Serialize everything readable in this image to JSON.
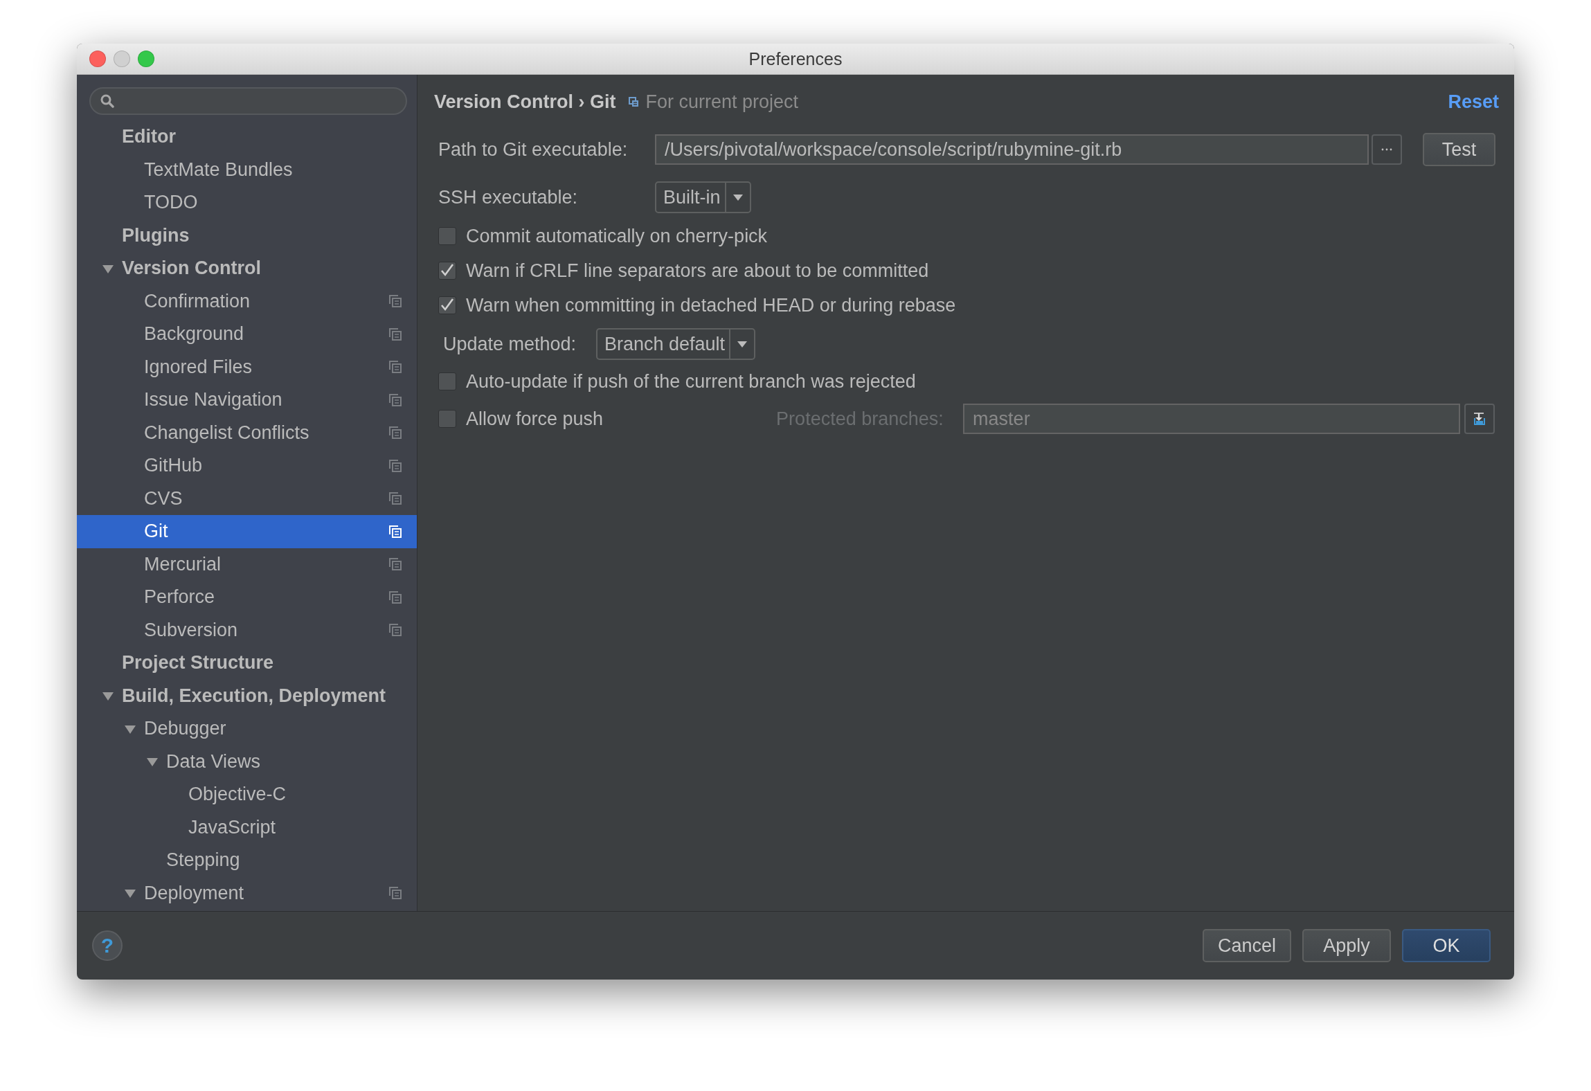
{
  "window": {
    "title": "Preferences",
    "traffic_lights": [
      {
        "kind": "close",
        "disabled": false
      },
      {
        "kind": "minimize",
        "disabled": true
      },
      {
        "kind": "zoom",
        "disabled": false
      }
    ]
  },
  "sidebar": {
    "items": [
      {
        "label": "Editor",
        "selected": false,
        "per_project": false,
        "children": [
          {
            "label": "TextMate Bundles",
            "selected": false,
            "per_project": false
          },
          {
            "label": "TODO",
            "selected": false,
            "per_project": false
          }
        ]
      },
      {
        "label": "Plugins",
        "selected": false,
        "per_project": false
      },
      {
        "label": "Version Control",
        "selected": false,
        "per_project": false,
        "expanded": true,
        "children": [
          {
            "label": "Confirmation",
            "selected": false,
            "per_project": true
          },
          {
            "label": "Background",
            "selected": false,
            "per_project": true
          },
          {
            "label": "Ignored Files",
            "selected": false,
            "per_project": true
          },
          {
            "label": "Issue Navigation",
            "selected": false,
            "per_project": true
          },
          {
            "label": "Changelist Conflicts",
            "selected": false,
            "per_project": true
          },
          {
            "label": "GitHub",
            "selected": false,
            "per_project": true
          },
          {
            "label": "CVS",
            "selected": false,
            "per_project": true
          },
          {
            "label": "Git",
            "selected": true,
            "per_project": true
          },
          {
            "label": "Mercurial",
            "selected": false,
            "per_project": true
          },
          {
            "label": "Perforce",
            "selected": false,
            "per_project": true
          },
          {
            "label": "Subversion",
            "selected": false,
            "per_project": true
          }
        ]
      },
      {
        "label": "Project Structure",
        "selected": false,
        "per_project": false
      },
      {
        "label": "Build, Execution, Deployment",
        "selected": false,
        "per_project": false,
        "expanded": true,
        "children": [
          {
            "label": "Debugger",
            "selected": false,
            "per_project": false,
            "expanded": true,
            "children": [
              {
                "label": "Data Views",
                "selected": false,
                "per_project": false,
                "expanded": true,
                "children": [
                  {
                    "label": "Objective-C",
                    "selected": false,
                    "per_project": false
                  },
                  {
                    "label": "JavaScript",
                    "selected": false,
                    "per_project": false
                  }
                ]
              },
              {
                "label": "Stepping",
                "selected": false,
                "per_project": false
              }
            ]
          },
          {
            "label": "Deployment",
            "selected": false,
            "per_project": true,
            "expanded": true
          }
        ]
      }
    ]
  },
  "header": {
    "breadcrumb": "Version Control › Git",
    "scope": "For current project",
    "reset": "Reset"
  },
  "form": {
    "rows": [
      {
        "kind": "path",
        "label": "Path to Git executable:",
        "value": "/Users/pivotal/workspace/console/script/rubymine-git.rb",
        "button": "Test"
      },
      {
        "kind": "select",
        "label": "SSH executable:",
        "value": "Built-in"
      },
      {
        "kind": "checkbox",
        "label": "Commit automatically on cherry-pick",
        "checked": false
      },
      {
        "kind": "checkbox",
        "label": "Warn if CRLF line separators are about to be committed",
        "checked": true
      },
      {
        "kind": "checkbox",
        "label": "Warn when committing in detached HEAD or during rebase",
        "checked": true
      },
      {
        "kind": "select",
        "label": "Update method:",
        "value": "Branch default"
      },
      {
        "kind": "checkbox",
        "label": "Auto-update if push of the current branch was rejected",
        "checked": false
      },
      {
        "kind": "checkbox_field",
        "label": "Allow force push",
        "checked": false,
        "field_label": "Protected branches:",
        "field_value": "master",
        "disabled": true
      }
    ]
  },
  "footer": {
    "help": "?",
    "buttons": [
      {
        "label": "Cancel",
        "default": false
      },
      {
        "label": "Apply",
        "default": false
      },
      {
        "label": "OK",
        "default": true
      }
    ]
  }
}
